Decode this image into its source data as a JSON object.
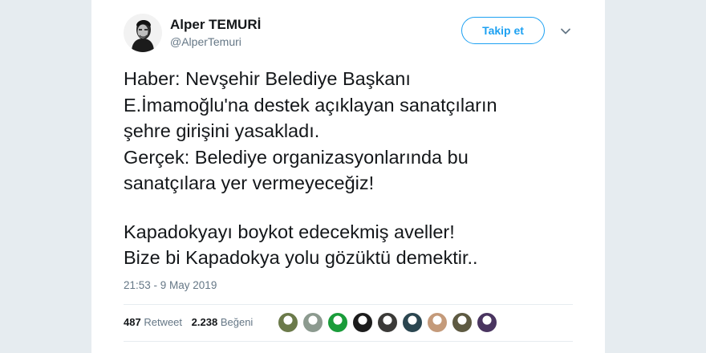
{
  "author": {
    "name": "Alper TEMURİ",
    "handle": "@AlperTemuri"
  },
  "follow_button": {
    "label": "Takip et"
  },
  "menu": {
    "icon": "chevron-down-icon"
  },
  "tweet": {
    "lines": [
      "Haber: Nevşehir Belediye Başkanı",
      "E.İmamoğlu'na destek açıklayan sanatçıların",
      "şehre girişini yasakladı.",
      "Gerçek: Belediye organizasyonlarında bu",
      "sanatçılara yer vermeyeceğiz!",
      "",
      "Kapadokyayı boykot edecekmiş aveller!",
      "Bize bi Kapadokya yolu gözüktü demektir.."
    ],
    "timestamp": "21:53 - 9 May 2019"
  },
  "stats": {
    "retweets": {
      "count": "487",
      "label": "Retweet"
    },
    "likes": {
      "count": "2.238",
      "label": "Beğeni"
    }
  },
  "likers": [
    {
      "name": "liker-avatar-1",
      "color": "#6b7a4a"
    },
    {
      "name": "liker-avatar-2",
      "color": "#8c9a8f"
    },
    {
      "name": "liker-avatar-3",
      "color": "#1a9c3a"
    },
    {
      "name": "liker-avatar-4",
      "color": "#1c1c1c"
    },
    {
      "name": "liker-avatar-5",
      "color": "#3b3a38"
    },
    {
      "name": "liker-avatar-6",
      "color": "#2b4650"
    },
    {
      "name": "liker-avatar-7",
      "color": "#c49a7a"
    },
    {
      "name": "liker-avatar-8",
      "color": "#5e5a42"
    },
    {
      "name": "liker-avatar-9",
      "color": "#4a3560"
    }
  ],
  "colors": {
    "accent": "#1da1f2",
    "text": "#14171a",
    "muted": "#657786",
    "background": "#e6ecf0"
  }
}
